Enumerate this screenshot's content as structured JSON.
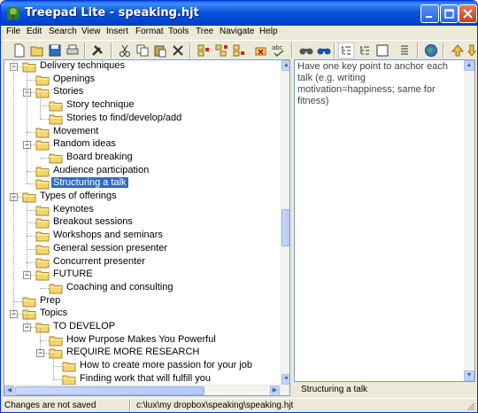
{
  "window": {
    "title": "Treepad Lite - speaking.hjt"
  },
  "menu": [
    "File",
    "Edit",
    "Search",
    "View",
    "Insert",
    "Format",
    "Tools",
    "Tree",
    "Navigate",
    "Help"
  ],
  "toolbar": {
    "icons": [
      "new-file-icon",
      "open-folder-icon",
      "save-icon",
      "print-icon",
      "tools-icon",
      "cut-icon",
      "copy-icon",
      "paste-icon",
      "delete-icon",
      "add-node-icon",
      "add-child-icon",
      "insert-node-icon",
      "delete-node-icon",
      "spellcheck-icon",
      "find-icon",
      "find-next-icon",
      "tree-view-icon",
      "tree-collapsed-icon",
      "blank-page-icon",
      "list-icon",
      "globe-icon",
      "up-arrow-icon"
    ]
  },
  "tree": {
    "nodes": [
      {
        "label": "Delivery techniques",
        "level": 0,
        "expander": "−"
      },
      {
        "label": "Openings",
        "level": 1,
        "expander": ""
      },
      {
        "label": "Stories",
        "level": 1,
        "expander": "−"
      },
      {
        "label": "Story technique",
        "level": 2,
        "expander": ""
      },
      {
        "label": "Stories to find/develop/add",
        "level": 2,
        "expander": ""
      },
      {
        "label": "Movement",
        "level": 1,
        "expander": ""
      },
      {
        "label": "Random ideas",
        "level": 1,
        "expander": "−"
      },
      {
        "label": "Board breaking",
        "level": 2,
        "expander": ""
      },
      {
        "label": "Audience participation",
        "level": 1,
        "expander": ""
      },
      {
        "label": "Structuring a talk",
        "level": 1,
        "expander": "",
        "selected": true
      },
      {
        "label": "Types of offerings",
        "level": 0,
        "expander": "−"
      },
      {
        "label": "Keynotes",
        "level": 1,
        "expander": ""
      },
      {
        "label": "Breakout sessions",
        "level": 1,
        "expander": ""
      },
      {
        "label": "Workshops and seminars",
        "level": 1,
        "expander": ""
      },
      {
        "label": "General session presenter",
        "level": 1,
        "expander": ""
      },
      {
        "label": "Concurrent presenter",
        "level": 1,
        "expander": ""
      },
      {
        "label": "FUTURE",
        "level": 1,
        "expander": "−"
      },
      {
        "label": "Coaching and consulting",
        "level": 2,
        "expander": ""
      },
      {
        "label": "Prep",
        "level": 0,
        "expander": ""
      },
      {
        "label": "Topics",
        "level": 0,
        "expander": "−"
      },
      {
        "label": "TO DEVELOP",
        "level": 1,
        "expander": "−"
      },
      {
        "label": "How Purpose Makes You Powerful",
        "level": 2,
        "expander": ""
      },
      {
        "label": "REQUIRE MORE RESEARCH",
        "level": 2,
        "expander": "−"
      },
      {
        "label": "How to create more passion for your job",
        "level": 3,
        "expander": ""
      },
      {
        "label": "Finding work that will fulfill you",
        "level": 3,
        "expander": ""
      }
    ]
  },
  "note": {
    "text": "Have one key point to anchor each talk (e.g. writing motivation=happiness; same for fitness)"
  },
  "node_title": "Structuring a talk",
  "status": {
    "saved": "Changes are not saved",
    "path": "c:\\lux\\my dropbox\\speaking\\speaking.hjt"
  },
  "colors": {
    "titlebar": "#0a54e0",
    "selection": "#316ac5",
    "folder": "#f5d66a"
  }
}
